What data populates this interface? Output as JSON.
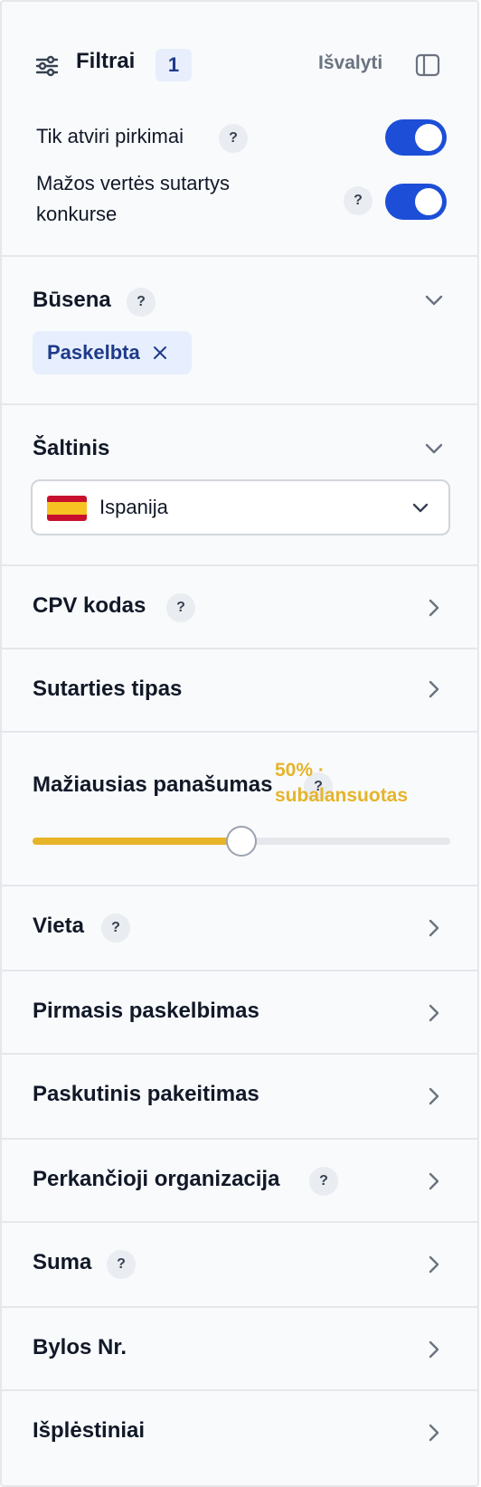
{
  "header": {
    "title": "Filtrai",
    "count": "1",
    "clear_label": "Išvalyti"
  },
  "toggles": [
    {
      "label": "Tik atviri pirkimai",
      "on": true
    },
    {
      "label_line1": "Mažos vertės sutartys",
      "label_line2": "konkurse",
      "on": true
    }
  ],
  "help_glyph": "?",
  "sections": {
    "busena": {
      "title": "Būsena",
      "chip": "Paskelbta"
    },
    "saltinis": {
      "title": "Šaltinis",
      "selected": "Ispanija",
      "flag": "spain-flag"
    },
    "cpv": {
      "title": "CPV kodas"
    },
    "sutarties_tipas": {
      "title": "Sutarties tipas"
    },
    "panasumas": {
      "title": "Mažiausias panašumas",
      "value_line1": "50% ·",
      "value_line2": "subalansuotas",
      "level_percent": 50
    },
    "vieta": {
      "title": "Vieta"
    },
    "pirmasis": {
      "title": "Pirmasis paskelbimas"
    },
    "paskutinis": {
      "title": "Paskutinis pakeitimas"
    },
    "perkancioji": {
      "title": "Perkančioji organizacija"
    },
    "suma": {
      "title": "Suma"
    },
    "bylos": {
      "title": "Bylos Nr."
    },
    "isplestiniai": {
      "title": "Išplėstiniai"
    }
  },
  "colors": {
    "accent": "#1d4ed8",
    "slider": "#e7b428",
    "chip_bg": "#e7eefd"
  }
}
